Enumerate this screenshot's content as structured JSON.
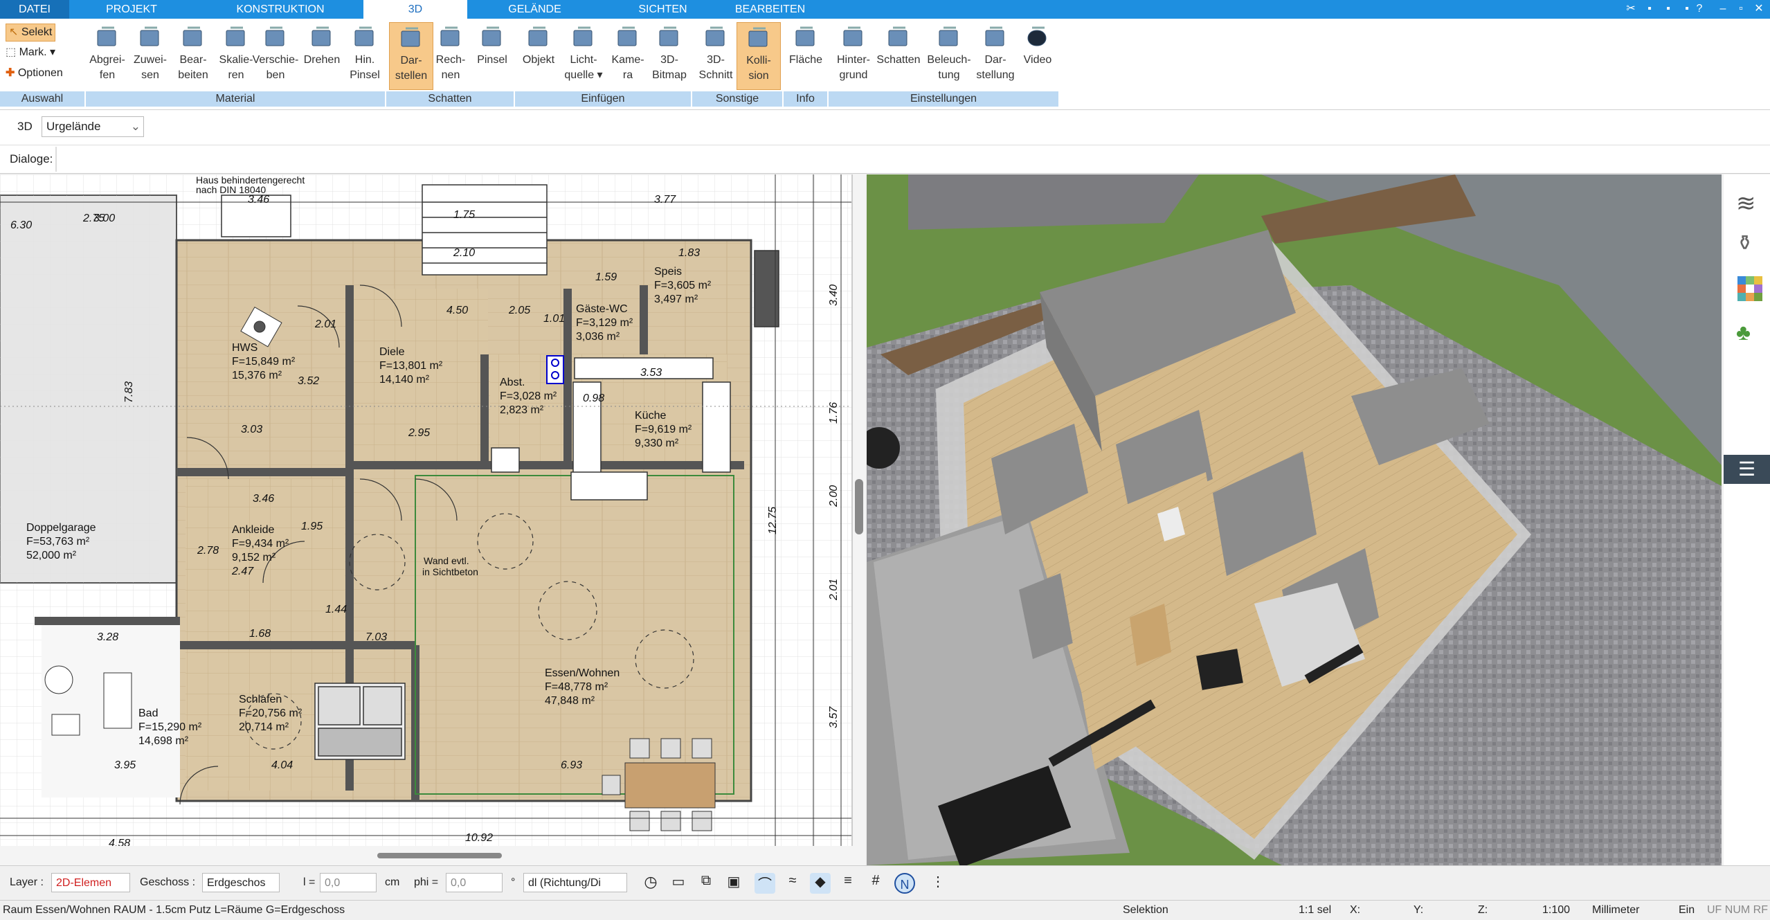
{
  "tabs": [
    "DATEI",
    "PROJEKT",
    "KONSTRUKTION",
    "3D",
    "GELÄNDE",
    "SICHTEN",
    "BEARBEITEN"
  ],
  "ribbon": {
    "auswahl": {
      "select": "Selekt",
      "mark": "Mark.",
      "options": "Optionen"
    },
    "buttons": [
      {
        "l1": "Abgrei-",
        "l2": "fen"
      },
      {
        "l1": "Zuwei-",
        "l2": "sen"
      },
      {
        "l1": "Bear-",
        "l2": "beiten"
      },
      {
        "l1": "Skalie-",
        "l2": "ren"
      },
      {
        "l1": "Verschie-",
        "l2": "ben"
      },
      {
        "l1": "Drehen",
        "l2": ""
      },
      {
        "l1": "Hin.",
        "l2": "Pinsel"
      },
      {
        "l1": "Dar-",
        "l2": "stellen"
      },
      {
        "l1": "Rech-",
        "l2": "nen"
      },
      {
        "l1": "Pinsel",
        "l2": ""
      },
      {
        "l1": "Objekt",
        "l2": ""
      },
      {
        "l1": "Licht-",
        "l2": "quelle ▾"
      },
      {
        "l1": "Kame-",
        "l2": "ra"
      },
      {
        "l1": "3D-",
        "l2": "Bitmap"
      },
      {
        "l1": "3D-",
        "l2": "Schnitt"
      },
      {
        "l1": "Kolli-",
        "l2": "sion"
      },
      {
        "l1": "Fläche",
        "l2": ""
      },
      {
        "l1": "Hinter-",
        "l2": "grund"
      },
      {
        "l1": "Schatten",
        "l2": ""
      },
      {
        "l1": "Beleuch-",
        "l2": "tung"
      },
      {
        "l1": "Dar-",
        "l2": "stellung"
      },
      {
        "l1": "Video",
        "l2": ""
      }
    ],
    "groups": [
      "Auswahl",
      "Material",
      "Schatten",
      "Einfügen",
      "Sonstige",
      "Info",
      "Einstellungen"
    ]
  },
  "row3d": {
    "label": "3D",
    "select": "Urgelände"
  },
  "dialoge": "Dialoge:",
  "rooms": [
    {
      "name": "HWS",
      "a": "F=15,849 m²",
      "b": "15,376 m²"
    },
    {
      "name": "Diele",
      "a": "F=13,801 m²",
      "b": "14,140 m²"
    },
    {
      "name": "Gäste-WC",
      "a": "F=3,129 m²",
      "b": "3,036 m²"
    },
    {
      "name": "Speis",
      "a": "F=3,605 m²",
      "b": "3,497 m²"
    },
    {
      "name": "Abst.",
      "a": "F=3,028 m²",
      "b": "2,823 m²"
    },
    {
      "name": "Küche",
      "a": "F=9,619 m²",
      "b": "9,330 m²"
    },
    {
      "name": "Doppelgarage",
      "a": "F=53,763 m²",
      "b": "52,000 m²"
    },
    {
      "name": "Ankleide",
      "a": "F=9,434 m²",
      "b": "9,152 m²"
    },
    {
      "name": "Schlafen",
      "a": "F=20,756 m²",
      "b": "20,714 m²"
    },
    {
      "name": "Bad",
      "a": "F=15,290 m²",
      "b": "14,698 m²"
    },
    {
      "name": "Essen/Wohnen",
      "a": "F=48,778 m²",
      "b": "47,848 m²"
    }
  ],
  "plan_notes": {
    "wand": "Wand evtl.",
    "sicht": "in Sichtbeton",
    "haus": "Haus behindertengerecht",
    "din": "nach DIN 18040"
  },
  "dims": [
    "3.46",
    "3.77",
    "6.30",
    "2.75",
    "3.00",
    "1.83",
    "3.40",
    "1.76",
    "2.00",
    "2.01",
    "3.57",
    "12.75",
    "1.75",
    "2.10",
    "4.50",
    "2.05",
    "1.01",
    "2.01",
    "3.52",
    "3.03",
    "2.95",
    "3.53",
    "3.46",
    "2.78",
    "2.47",
    "1.95",
    "1.44",
    "1.68",
    "7.03",
    "3.28",
    "3.95",
    "4.04",
    "6.93",
    "4.58",
    "10.92",
    "7.83",
    "1.59",
    "0.98"
  ],
  "bottombar": {
    "layer_label": "Layer :",
    "layer_value": "2D-Elemen",
    "geschoss_label": "Geschoss :",
    "geschoss_value": "Erdgeschos",
    "l_label": "l =",
    "l_value": "0,0",
    "cm": "cm",
    "phi_label": "phi =",
    "phi_value": "0,0",
    "deg": "°",
    "dl_value": "dl (Richtung/Di"
  },
  "status": {
    "text": "Raum Essen/Wohnen RAUM - 1.5cm Putz L=Räume G=Erdgeschoss",
    "mode": "Selektion",
    "sel": "1:1 sel",
    "x": "X:",
    "y": "Y:",
    "z": "Z:",
    "scale": "1:100",
    "unit": "Millimeter",
    "ein": "Ein",
    "flags": "UF NUM RF"
  },
  "colors": {
    "tabbar": "#1e8fe0",
    "group": "#bcd9f3",
    "highlight": "#f7c98a",
    "floor": "#dcc9a6",
    "grass": "#6b9146"
  }
}
